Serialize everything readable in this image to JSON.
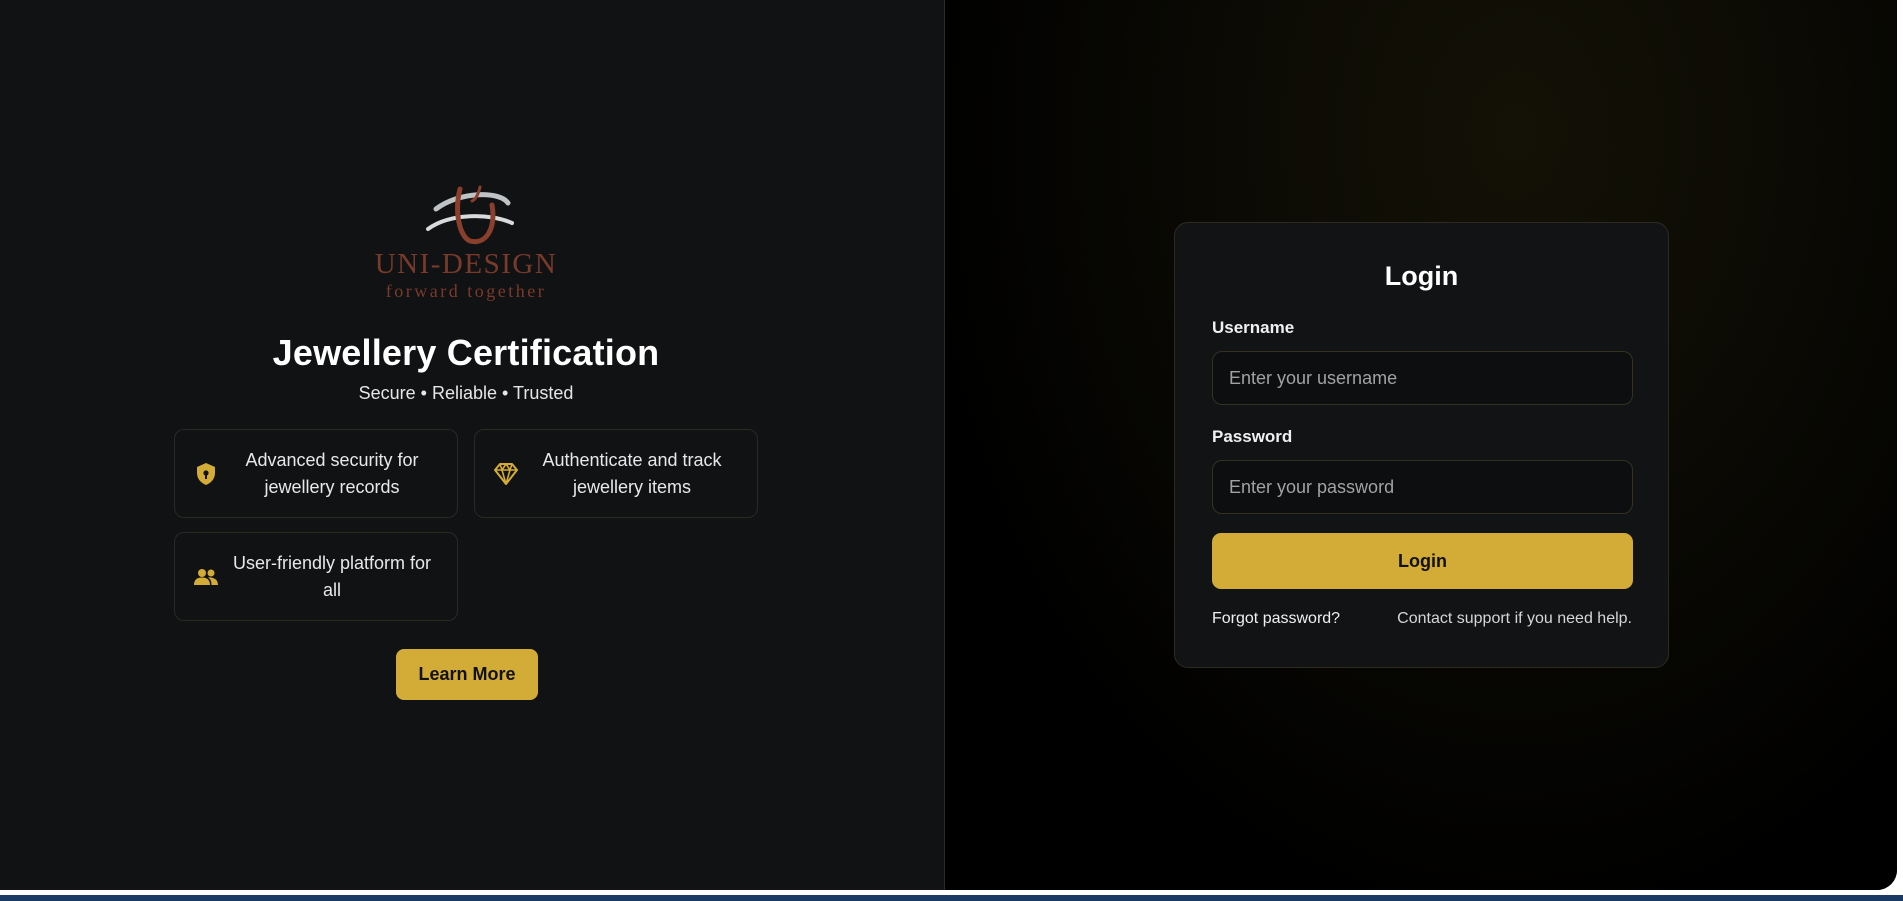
{
  "brand": {
    "logo_name": "UNI-DESIGN",
    "logo_tagline": "forward together"
  },
  "hero": {
    "title": "Jewellery Certification",
    "subtitle": "Secure • Reliable • Trusted"
  },
  "features": [
    {
      "icon": "shield-lock-icon",
      "text": "Advanced security for jewellery records"
    },
    {
      "icon": "diamond-icon",
      "text": "Authenticate and track jewellery items"
    },
    {
      "icon": "users-icon",
      "text": "User-friendly platform for all"
    }
  ],
  "learn_more_label": "Learn More",
  "login": {
    "title": "Login",
    "username_label": "Username",
    "username_placeholder": "Enter your username",
    "username_value": "",
    "password_label": "Password",
    "password_placeholder": "Enter your password",
    "password_value": "",
    "submit_label": "Login",
    "forgot_label": "Forgot password?",
    "support_text": "Contact support if you need help."
  },
  "colors": {
    "accent": "#d3ac37",
    "left_background": "#111214",
    "right_background": "#000000",
    "logo_red": "#8a3f2c"
  }
}
